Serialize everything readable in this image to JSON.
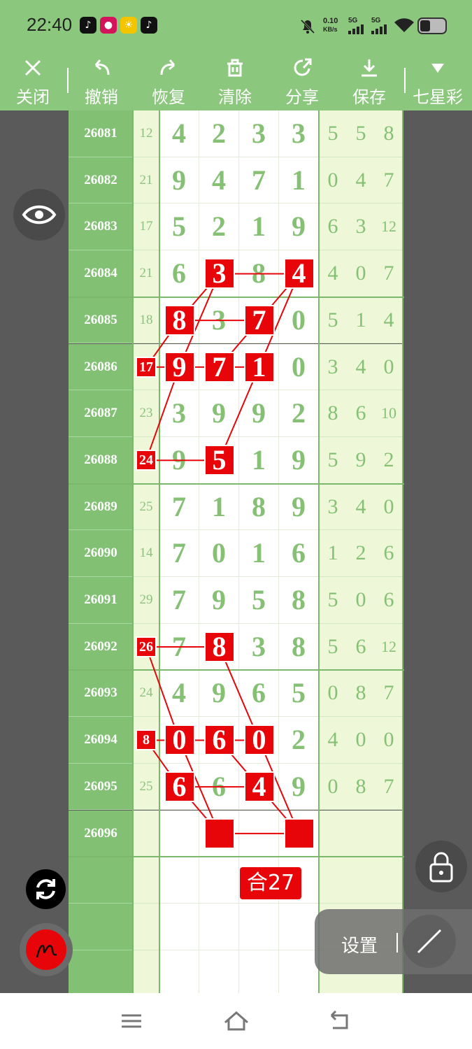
{
  "status": {
    "time": "22:40",
    "net_rate_value": "0.10",
    "net_rate_unit": "KB/s",
    "sim1": "5G",
    "sim2": "5G"
  },
  "toolbar": {
    "close": "关闭",
    "undo": "撤销",
    "redo": "恢复",
    "clear": "清除",
    "share": "分享",
    "save": "保存",
    "lottery": "七星彩"
  },
  "rows": [
    {
      "id": "26081",
      "sum": "12",
      "d": [
        "4",
        "2",
        "3",
        "3"
      ],
      "r": [
        "5",
        "5",
        "8"
      ]
    },
    {
      "id": "26082",
      "sum": "21",
      "d": [
        "9",
        "4",
        "7",
        "1"
      ],
      "r": [
        "0",
        "4",
        "7"
      ]
    },
    {
      "id": "26083",
      "sum": "17",
      "d": [
        "5",
        "2",
        "1",
        "9"
      ],
      "r": [
        "6",
        "3",
        "12"
      ]
    },
    {
      "id": "26084",
      "sum": "21",
      "d": [
        "6",
        "3",
        "8",
        "4"
      ],
      "r": [
        "4",
        "0",
        "7"
      ]
    },
    {
      "id": "26085",
      "sum": "18",
      "d": [
        "8",
        "3",
        "7",
        "0"
      ],
      "r": [
        "5",
        "1",
        "4"
      ]
    },
    {
      "id": "26086",
      "sum": "17",
      "d": [
        "9",
        "7",
        "1",
        "0"
      ],
      "r": [
        "3",
        "4",
        "0"
      ]
    },
    {
      "id": "26087",
      "sum": "23",
      "d": [
        "3",
        "9",
        "9",
        "2"
      ],
      "r": [
        "8",
        "6",
        "10"
      ]
    },
    {
      "id": "26088",
      "sum": "24",
      "d": [
        "9",
        "5",
        "1",
        "9"
      ],
      "r": [
        "5",
        "9",
        "2"
      ]
    },
    {
      "id": "26089",
      "sum": "25",
      "d": [
        "7",
        "1",
        "8",
        "9"
      ],
      "r": [
        "3",
        "4",
        "0"
      ]
    },
    {
      "id": "26090",
      "sum": "14",
      "d": [
        "7",
        "0",
        "1",
        "6"
      ],
      "r": [
        "1",
        "2",
        "6"
      ]
    },
    {
      "id": "26091",
      "sum": "29",
      "d": [
        "7",
        "9",
        "5",
        "8"
      ],
      "r": [
        "5",
        "0",
        "6"
      ]
    },
    {
      "id": "26092",
      "sum": "26",
      "d": [
        "7",
        "8",
        "3",
        "8"
      ],
      "r": [
        "5",
        "6",
        "12"
      ]
    },
    {
      "id": "26093",
      "sum": "24",
      "d": [
        "4",
        "9",
        "6",
        "5"
      ],
      "r": [
        "0",
        "8",
        "7"
      ]
    },
    {
      "id": "26094",
      "sum": "8",
      "d": [
        "0",
        "6",
        "0",
        "2"
      ],
      "r": [
        "4",
        "0",
        "0"
      ]
    },
    {
      "id": "26095",
      "sum": "25",
      "d": [
        "6",
        "6",
        "4",
        "9"
      ],
      "r": [
        "0",
        "8",
        "7"
      ]
    },
    {
      "id": "26096",
      "sum": "",
      "d": [
        "",
        "",
        "",
        ""
      ],
      "r": [
        "",
        "",
        ""
      ]
    },
    {
      "id": "",
      "sum": "",
      "d": [
        "",
        "",
        "",
        ""
      ],
      "r": [
        "",
        "",
        ""
      ]
    },
    {
      "id": "",
      "sum": "",
      "d": [
        "",
        "",
        "",
        ""
      ],
      "r": [
        "",
        "",
        ""
      ]
    },
    {
      "id": "",
      "sum": "",
      "d": [
        "",
        "",
        "",
        ""
      ],
      "r": [
        "",
        "",
        ""
      ]
    }
  ],
  "marks": [
    {
      "row": 3,
      "col": 1
    },
    {
      "row": 3,
      "col": 3
    },
    {
      "row": 4,
      "col": 0
    },
    {
      "row": 4,
      "col": 2
    },
    {
      "row": 5,
      "col": 0
    },
    {
      "row": 5,
      "col": 1
    },
    {
      "row": 5,
      "col": 2
    },
    {
      "row": 7,
      "col": 1
    },
    {
      "row": 11,
      "col": 1
    },
    {
      "row": 13,
      "col": 0
    },
    {
      "row": 13,
      "col": 1
    },
    {
      "row": 13,
      "col": 2
    },
    {
      "row": 14,
      "col": 0
    },
    {
      "row": 14,
      "col": 2
    },
    {
      "row": 15,
      "col": 1
    },
    {
      "row": 15,
      "col": 3
    }
  ],
  "sum_marks": [
    {
      "row": 5,
      "value": "17"
    },
    {
      "row": 7,
      "value": "24"
    },
    {
      "row": 11,
      "value": "26"
    },
    {
      "row": 13,
      "value": "8"
    }
  ],
  "sum_label": "合27",
  "settings_label": "设置",
  "accent": "#8bc77c",
  "mark_color": "#e8050a"
}
